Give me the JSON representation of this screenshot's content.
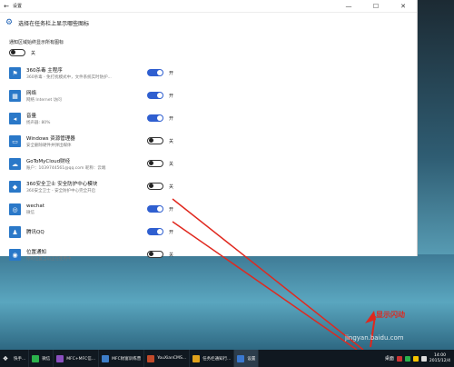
{
  "window": {
    "titlebar_title": "设置",
    "back_glyph": "←",
    "minimize_glyph": "—",
    "maximize_glyph": "☐",
    "close_glyph": "✕",
    "page_title": "选择在任务栏上显示哪些图标"
  },
  "master": {
    "label": "通知区域始终显示所有图标",
    "state_label": "关",
    "on": false
  },
  "items": [
    {
      "icon": "360-icon",
      "glyph": "⚑",
      "name": "360杀毒 主程序",
      "desc": "360杀毒 - 免打扰模式中，文件系统实时防护...",
      "on": true,
      "state_label": "开"
    },
    {
      "icon": "network-icon",
      "glyph": "▦",
      "name": "网络",
      "desc": "网络 Internet 访问",
      "on": true,
      "state_label": "开"
    },
    {
      "icon": "volume-icon",
      "glyph": "◂",
      "name": "音量",
      "desc": "扬声器: 80%",
      "on": true,
      "state_label": "开"
    },
    {
      "icon": "usb-icon",
      "glyph": "▭",
      "name": "Windows 资源管理器",
      "desc": "安全删除硬件并弹出媒体",
      "on": false,
      "state_label": "关"
    },
    {
      "icon": "cloud-icon",
      "glyph": "☁",
      "name": "GoToMyCloud财经",
      "desc": "账户：1039744561@qq.com 昵称：云端",
      "on": false,
      "state_label": "关"
    },
    {
      "icon": "shield-icon",
      "glyph": "◆",
      "name": "360安全卫士 安全防护中心模块",
      "desc": "360安全卫士 - 安全防护中心完全开启",
      "on": false,
      "state_label": "关"
    },
    {
      "icon": "wechat-icon",
      "glyph": "◎",
      "name": "wechat",
      "desc": "微信",
      "on": true,
      "state_label": "开"
    },
    {
      "icon": "qq-icon",
      "glyph": "♟",
      "name": "腾讯QQ",
      "desc": "",
      "on": true,
      "state_label": "开"
    },
    {
      "icon": "location-icon",
      "glyph": "◉",
      "name": "位置通知",
      "desc": "你的位置当前正在使用中",
      "on": false,
      "state_label": "关"
    }
  ],
  "annotation": "显示闪动",
  "watermark": "jingyan.baidu.com",
  "taskbar": {
    "left_label": "快手...",
    "items": [
      {
        "label": "微信",
        "color": "#2bb24c",
        "active": false
      },
      {
        "label": "MFC+MFC信...",
        "color": "#8a4fbf",
        "active": false
      },
      {
        "label": "MFC财富训练营",
        "color": "#3d7dc8",
        "active": false
      },
      {
        "label": "YouXianCMS...",
        "color": "#c24a2a",
        "active": false
      },
      {
        "label": "任务栏通知行...",
        "color": "#e0a21c",
        "active": false
      },
      {
        "label": "设置",
        "color": "#3a78d0",
        "active": true
      }
    ],
    "tray_label": "桌面",
    "time": "14:00",
    "date": "2015/12/4"
  },
  "colors": {
    "toggle_on": "#2f5fd0",
    "arrow": "#e0281e"
  }
}
